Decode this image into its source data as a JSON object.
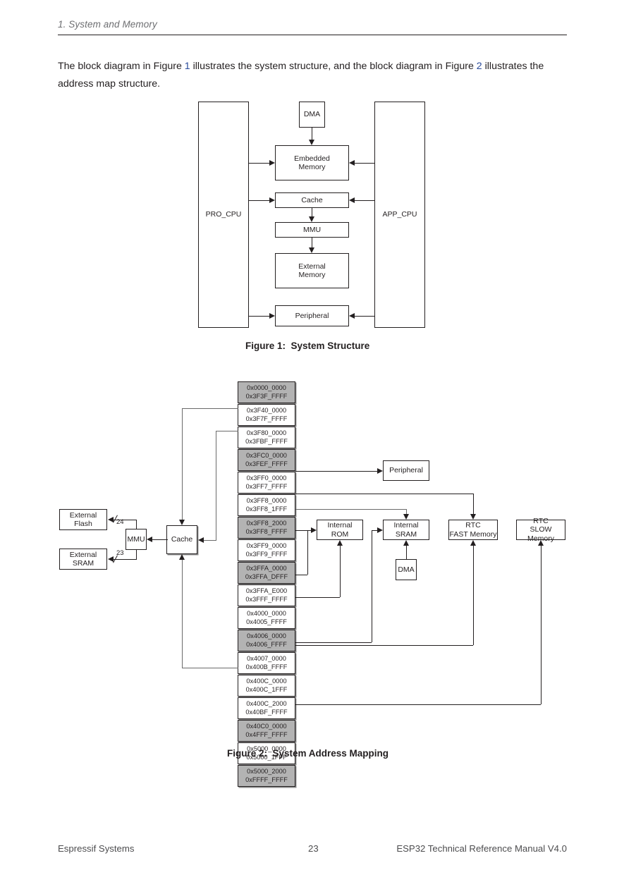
{
  "header": {
    "section": "1. System and Memory"
  },
  "intro": {
    "part1": "The block diagram in Figure ",
    "ref1": "1",
    "part2": " illustrates the system structure, and the block diagram in Figure ",
    "ref2": "2",
    "part3": " illustrates the",
    "line2": "address map structure."
  },
  "figure1": {
    "caption": "Figure 1:  System Structure",
    "nodes": {
      "pro_cpu": "PRO_CPU",
      "app_cpu": "APP_CPU",
      "dma": "DMA",
      "embedded_memory": "Embedded\nMemory",
      "cache": "Cache",
      "mmu": "MMU",
      "external_memory": "External\nMemory",
      "peripheral": "Peripheral"
    }
  },
  "figure2": {
    "caption": "Figure 2:  System Address Mapping",
    "nodes": {
      "external_flash": "External\nFlash",
      "external_sram": "External\nSRAM",
      "mmu": "MMU",
      "cache": "Cache",
      "peripheral": "Peripheral",
      "internal_rom": "Internal\nROM",
      "internal_sram": "Internal\nSRAM",
      "dma": "DMA",
      "rtc_fast": "RTC\nFAST Memory",
      "rtc_slow": "RTC\nSLOW Memory"
    },
    "bus_widths": {
      "flash": "24",
      "sram": "23"
    },
    "address_rows": [
      {
        "start": "0x0000_0000",
        "end": "0x3F3F_FFFF",
        "shaded": true
      },
      {
        "start": "0x3F40_0000",
        "end": "0x3F7F_FFFF",
        "shaded": false
      },
      {
        "start": "0x3F80_0000",
        "end": "0x3FBF_FFFF",
        "shaded": false
      },
      {
        "start": "0x3FC0_0000",
        "end": "0x3FEF_FFFF",
        "shaded": true
      },
      {
        "start": "0x3FF0_0000",
        "end": "0x3FF7_FFFF",
        "shaded": false
      },
      {
        "start": "0x3FF8_0000",
        "end": "0x3FF8_1FFF",
        "shaded": false
      },
      {
        "start": "0x3FF8_2000",
        "end": "0x3FF8_FFFF",
        "shaded": true
      },
      {
        "start": "0x3FF9_0000",
        "end": "0x3FF9_FFFF",
        "shaded": false
      },
      {
        "start": "0x3FFA_0000",
        "end": "0x3FFA_DFFF",
        "shaded": true
      },
      {
        "start": "0x3FFA_E000",
        "end": "0x3FFF_FFFF",
        "shaded": false
      },
      {
        "start": "0x4000_0000",
        "end": "0x4005_FFFF",
        "shaded": false
      },
      {
        "start": "0x4006_0000",
        "end": "0x4006_FFFF",
        "shaded": true
      },
      {
        "start": "0x4007_0000",
        "end": "0x400B_FFFF",
        "shaded": false
      },
      {
        "start": "0x400C_0000",
        "end": "0x400C_1FFF",
        "shaded": false
      },
      {
        "start": "0x400C_2000",
        "end": "0x40BF_FFFF",
        "shaded": false
      },
      {
        "start": "0x40C0_0000",
        "end": "0x4FFF_FFFF",
        "shaded": true
      },
      {
        "start": "0x5000_0000",
        "end": "0x5000_1FFF",
        "shaded": false
      },
      {
        "start": "0x5000_2000",
        "end": "0xFFFF_FFFF",
        "shaded": true
      }
    ]
  },
  "footer": {
    "left": "Espressif Systems",
    "center": "23",
    "right": "ESP32 Technical Reference Manual V4.0"
  }
}
